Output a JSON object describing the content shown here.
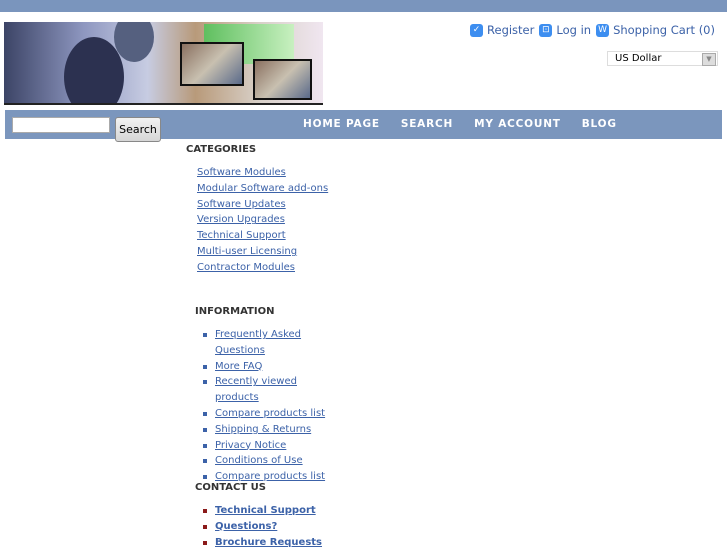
{
  "header": {
    "user_links": [
      {
        "label": "Register",
        "icon": "check-icon"
      },
      {
        "label": "Log in",
        "icon": "login-icon"
      },
      {
        "label": "Shopping Cart (0)",
        "icon": "cart-icon"
      }
    ],
    "currency": {
      "selected": "US Dollar"
    }
  },
  "nav": {
    "search_button": "Search",
    "search_value": "",
    "items": [
      "HOME PAGE",
      "SEARCH",
      "MY ACCOUNT",
      "BLOG"
    ]
  },
  "categories": {
    "title": "CATEGORIES",
    "items": [
      "Software Modules",
      "Modular Software add-ons",
      "Software Updates",
      "Version Upgrades",
      "Technical Support",
      "Multi-user Licensing",
      "Contractor Modules"
    ]
  },
  "information": {
    "title": "INFORMATION",
    "items": [
      "Frequently Asked Questions",
      "More FAQ",
      "Recently viewed products",
      "Compare products list",
      "Shipping & Returns",
      "Privacy Notice",
      "Conditions of Use",
      "Compare products list"
    ]
  },
  "contact": {
    "title": "CONTACT US",
    "items": [
      "Technical Support",
      "Questions?",
      "Brochure Requests"
    ]
  },
  "colors": {
    "bar": "#7b96bd",
    "link": "#3c62a8",
    "contact_bullet": "#8b1a1a"
  }
}
